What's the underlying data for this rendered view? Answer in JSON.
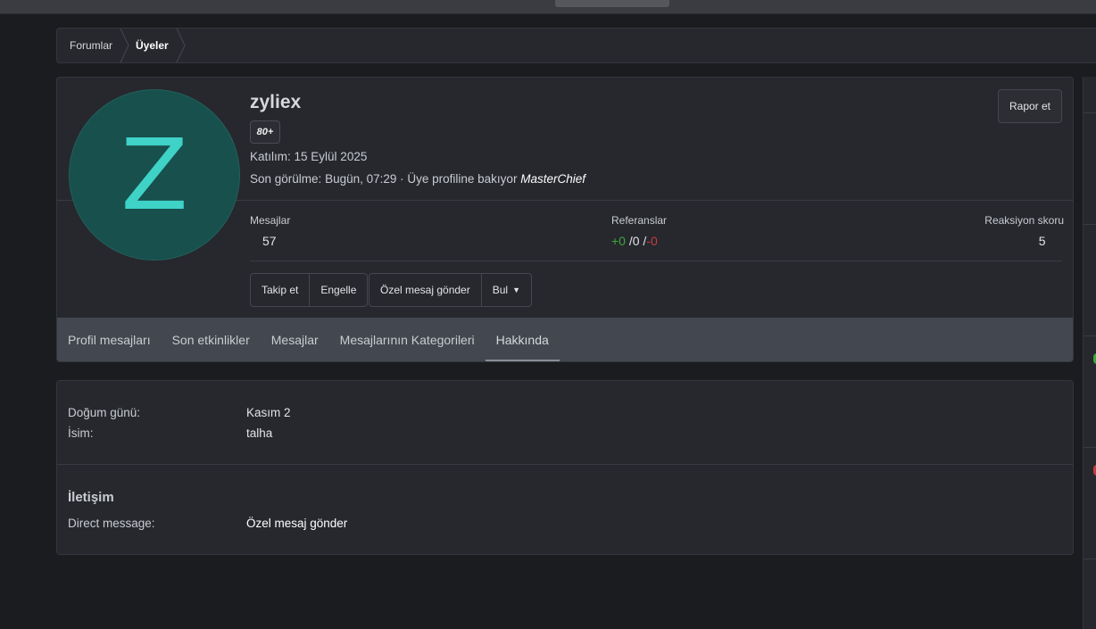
{
  "breadcrumb": {
    "items": [
      "Forumlar",
      "Üyeler"
    ]
  },
  "profile": {
    "avatar_letter": "Z",
    "username": "zyliex",
    "badge": "80+",
    "joined_label": "Katılım:",
    "joined_value": "15 Eylül 2025",
    "seen_label": "Son görülme:",
    "seen_value": "Bugün, 07:29 · Üye profiline bakıyor",
    "seen_user": "MasterChief",
    "report_button": "Rapor et"
  },
  "stats": {
    "messages_label": "Mesajlar",
    "messages_value": "57",
    "refs_label": "Referanslar",
    "refs_pos": "+0",
    "refs_neutral": "0",
    "refs_neg": "-0",
    "reaction_label": "Reaksiyon skoru",
    "reaction_value": "5"
  },
  "actions": {
    "follow": "Takip et",
    "block": "Engelle",
    "private_message": "Özel mesaj gönder",
    "find": "Bul"
  },
  "tabs": [
    "Profil mesajları",
    "Son etkinlikler",
    "Mesajlar",
    "Mesajlarının Kategorileri",
    "Hakkında"
  ],
  "about": {
    "birthday_label": "Doğum günü:",
    "birthday_value": "Kasım 2",
    "name_label": "İsim:",
    "name_value": "talha",
    "contact_title": "İletişim",
    "dm_label": "Direct message:",
    "dm_value": "Özel mesaj gönder"
  },
  "colors": {
    "avatar_bg": "#17504d",
    "avatar_letter": "#3fd2c7",
    "positive": "#3aa83a",
    "negative": "#c33d3d"
  }
}
